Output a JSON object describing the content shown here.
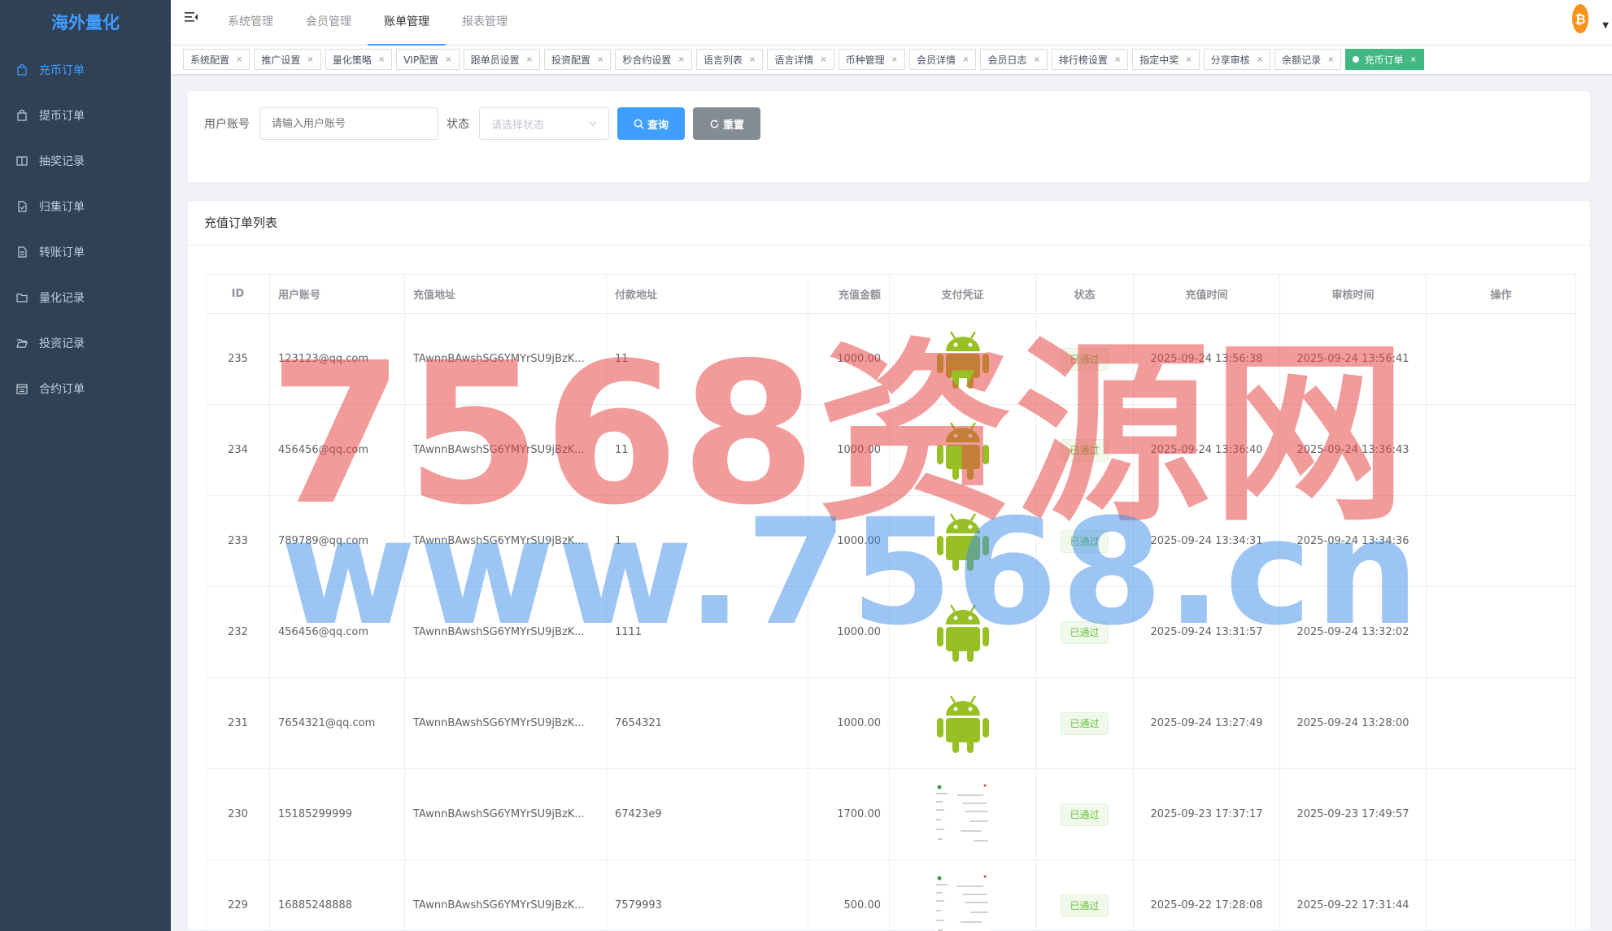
{
  "app": {
    "logo": "海外量化"
  },
  "sidebar": {
    "items": [
      {
        "label": "充币订单",
        "icon": "shopping-bag-icon",
        "active": true
      },
      {
        "label": "提币订单",
        "icon": "shopping-bag-icon",
        "active": false
      },
      {
        "label": "抽奖记录",
        "icon": "book-icon",
        "active": false
      },
      {
        "label": "归集订单",
        "icon": "document-icon",
        "active": false
      },
      {
        "label": "转账订单",
        "icon": "document-list-icon",
        "active": false
      },
      {
        "label": "量化记录",
        "icon": "folder-icon",
        "active": false
      },
      {
        "label": "投资记录",
        "icon": "folder-open-icon",
        "active": false
      },
      {
        "label": "合约订单",
        "icon": "calendar-icon",
        "active": false
      }
    ]
  },
  "topnav": {
    "items": [
      {
        "label": "系统管理",
        "active": false
      },
      {
        "label": "会员管理",
        "active": false
      },
      {
        "label": "账单管理",
        "active": true
      },
      {
        "label": "报表管理",
        "active": false
      }
    ]
  },
  "tags": [
    {
      "label": "系统配置",
      "active": false
    },
    {
      "label": "推广设置",
      "active": false
    },
    {
      "label": "量化策略",
      "active": false
    },
    {
      "label": "VIP配置",
      "active": false
    },
    {
      "label": "跟单员设置",
      "active": false
    },
    {
      "label": "投资配置",
      "active": false
    },
    {
      "label": "秒合约设置",
      "active": false
    },
    {
      "label": "语言列表",
      "active": false
    },
    {
      "label": "语言详情",
      "active": false
    },
    {
      "label": "币种管理",
      "active": false
    },
    {
      "label": "会员详情",
      "active": false
    },
    {
      "label": "会员日志",
      "active": false
    },
    {
      "label": "排行榜设置",
      "active": false
    },
    {
      "label": "指定中奖",
      "active": false
    },
    {
      "label": "分享审核",
      "active": false
    },
    {
      "label": "余额记录",
      "active": false
    },
    {
      "label": "充币订单",
      "active": true
    }
  ],
  "search": {
    "account_label": "用户账号",
    "account_placeholder": "请输入用户账号",
    "status_label": "状态",
    "status_placeholder": "请选择状态",
    "query_label": "查询",
    "reset_label": "重置"
  },
  "list": {
    "title": "充值订单列表",
    "columns": [
      "ID",
      "用户账号",
      "充值地址",
      "付款地址",
      "充值金额",
      "支付凭证",
      "状态",
      "充值时间",
      "审核时间",
      "操作"
    ],
    "rows": [
      {
        "id": "235",
        "account": "123123@qq.com",
        "address": "TAwnnBAwshSG6YMYrSU9jBzK...",
        "pay": "11",
        "amount": "1000.00",
        "proof": "android",
        "status": "已通过",
        "time": "2025-09-24 13:56:38",
        "audit": "2025-09-24 13:56:41"
      },
      {
        "id": "234",
        "account": "456456@qq.com",
        "address": "TAwnnBAwshSG6YMYrSU9jBzK...",
        "pay": "11",
        "amount": "1000.00",
        "proof": "android",
        "status": "已通过",
        "time": "2025-09-24 13:36:40",
        "audit": "2025-09-24 13:36:43"
      },
      {
        "id": "233",
        "account": "789789@qq.com",
        "address": "TAwnnBAwshSG6YMYrSU9jBzK...",
        "pay": "1",
        "amount": "1000.00",
        "proof": "android",
        "status": "已通过",
        "time": "2025-09-24 13:34:31",
        "audit": "2025-09-24 13:34:36"
      },
      {
        "id": "232",
        "account": "456456@qq.com",
        "address": "TAwnnBAwshSG6YMYrSU9jBzK...",
        "pay": "1111",
        "amount": "1000.00",
        "proof": "android",
        "status": "已通过",
        "time": "2025-09-24 13:31:57",
        "audit": "2025-09-24 13:32:02"
      },
      {
        "id": "231",
        "account": "7654321@qq.com",
        "address": "TAwnnBAwshSG6YMYrSU9jBzK...",
        "pay": "7654321",
        "amount": "1000.00",
        "proof": "android",
        "status": "已通过",
        "time": "2025-09-24 13:27:49",
        "audit": "2025-09-24 13:28:00"
      },
      {
        "id": "230",
        "account": "15185299999",
        "address": "TAwnnBAwshSG6YMYrSU9jBzK...",
        "pay": "67423e9",
        "amount": "1700.00",
        "proof": "receipt",
        "status": "已通过",
        "time": "2025-09-23 17:37:17",
        "audit": "2025-09-23 17:49:57"
      },
      {
        "id": "229",
        "account": "16885248888",
        "address": "TAwnnBAwshSG6YMYrSU9jBzK...",
        "pay": "7579993",
        "amount": "500.00",
        "proof": "receipt",
        "status": "已通过",
        "time": "2025-09-22 17:28:08",
        "audit": "2025-09-22 17:31:44"
      }
    ]
  },
  "watermark": {
    "line1": "7568资源网",
    "line2": "www.7568.cn"
  },
  "colors": {
    "sidebar": "#304156",
    "primary": "#409eff",
    "success": "#67c23a",
    "tag_active": "#42b983"
  }
}
